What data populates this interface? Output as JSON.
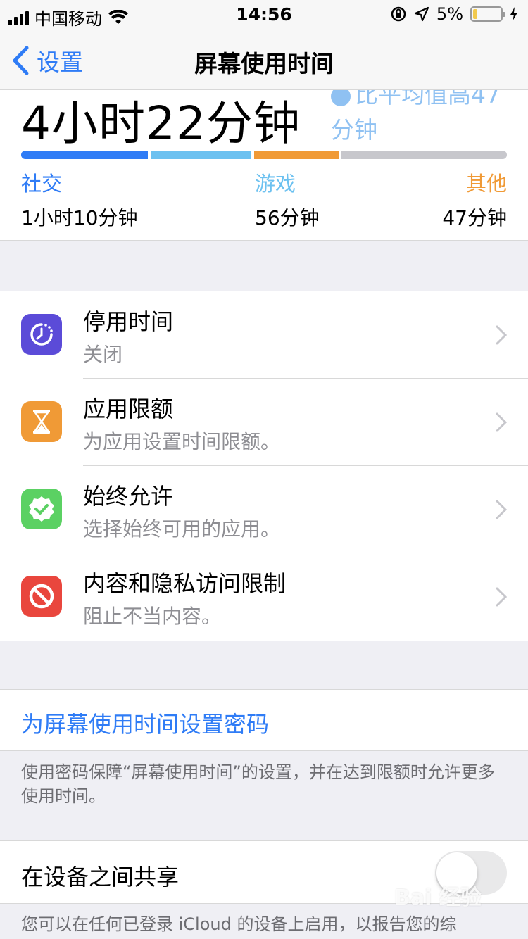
{
  "status_bar": {
    "carrier": "中国移动",
    "time": "14:56",
    "battery_percent": "5%",
    "battery_level": 0.05,
    "icons": [
      "signal-icon",
      "wifi-icon",
      "orientation-lock-icon",
      "location-icon",
      "battery-icon",
      "charging-icon"
    ]
  },
  "nav": {
    "back_label": "设置",
    "title": "屏幕使用时间"
  },
  "summary": {
    "total_time": "4小时22分钟",
    "compare_text": "比平均值高47",
    "compare_text_line2": "分钟",
    "categories": [
      {
        "name": "社交",
        "value": "1小时10分钟",
        "color": "#2f7cf6",
        "minutes": 70
      },
      {
        "name": "游戏",
        "value": "56分钟",
        "color": "#6cc1f0",
        "minutes": 56
      },
      {
        "name": "其他",
        "value": "47分钟",
        "color": "#f09a36",
        "minutes": 47
      }
    ],
    "remaining_color": "#c7c7cc"
  },
  "settings": [
    {
      "title": "停用时间",
      "subtitle": "关闭",
      "icon": "downtime-icon",
      "icon_color": "#5b4bd8"
    },
    {
      "title": "应用限额",
      "subtitle": "为应用设置时间限额。",
      "icon": "hourglass-icon",
      "icon_color": "#f09a36"
    },
    {
      "title": "始终允许",
      "subtitle": "选择始终可用的应用。",
      "icon": "checkmark-seal-icon",
      "icon_color": "#5bd163"
    },
    {
      "title": "内容和隐私访问限制",
      "subtitle": "阻止不当内容。",
      "icon": "restriction-icon",
      "icon_color": "#e9463d"
    }
  ],
  "passcode": {
    "label": "为屏幕使用时间设置密码",
    "note": "使用密码保障“屏幕使用时间”的设置，并在达到限额时允许更多使用时间。"
  },
  "share": {
    "label": "在设备之间共享",
    "enabled": false,
    "note": "您可以在任何已登录 iCloud 的设备上启用，以报告您的综"
  },
  "watermark": "Bai 经验"
}
